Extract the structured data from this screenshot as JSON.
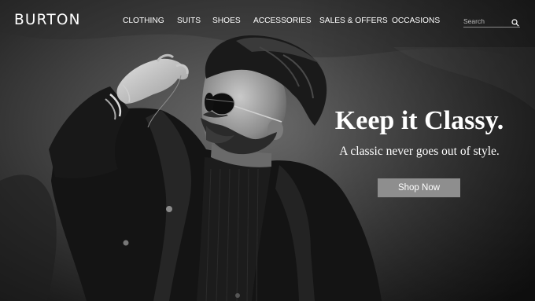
{
  "brand": {
    "logo_text": "BURTON"
  },
  "nav": {
    "items": [
      "CLOTHING",
      "SUITS",
      "SHOES",
      "ACCESSORIES",
      "SALES & OFFERS",
      "OCCASIONS"
    ]
  },
  "search": {
    "placeholder": "Search",
    "icon": "magnifier-icon"
  },
  "hero": {
    "headline": "Keep it Classy.",
    "tagline": "A classic never goes out of style.",
    "cta_label": "Shop Now",
    "image": "black-and-white portrait of bearded man in sunglasses and dark jacket"
  },
  "colors": {
    "text": "#ffffff",
    "cta_background": "#8e8e8e",
    "search_underline": "#8a8a8a"
  }
}
